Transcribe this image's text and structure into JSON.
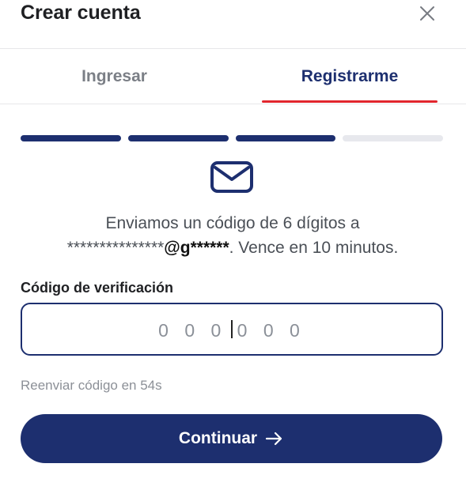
{
  "modal": {
    "title": "Crear cuenta",
    "close_icon": "close-icon"
  },
  "tabs": [
    {
      "label": "Ingresar",
      "active": false
    },
    {
      "label": "Registrarme",
      "active": true
    }
  ],
  "progress": {
    "completed_steps": 3,
    "total_steps": 4
  },
  "message": {
    "line1": "Enviamos un código de 6 dígitos a",
    "masked_user": "***************",
    "masked_domain": "@g******",
    "line2_suffix": ". Vence en 10 minutos."
  },
  "verification": {
    "label": "Código de verificación",
    "placeholder": "0 0 0 0 0 0"
  },
  "resend": "Reenviar código en 54s",
  "continue": {
    "label": "Continuar",
    "icon": "arrow-right-icon"
  },
  "colors": {
    "primary": "#1d2f6f",
    "accent": "#e1262d",
    "muted": "#8c9097"
  }
}
